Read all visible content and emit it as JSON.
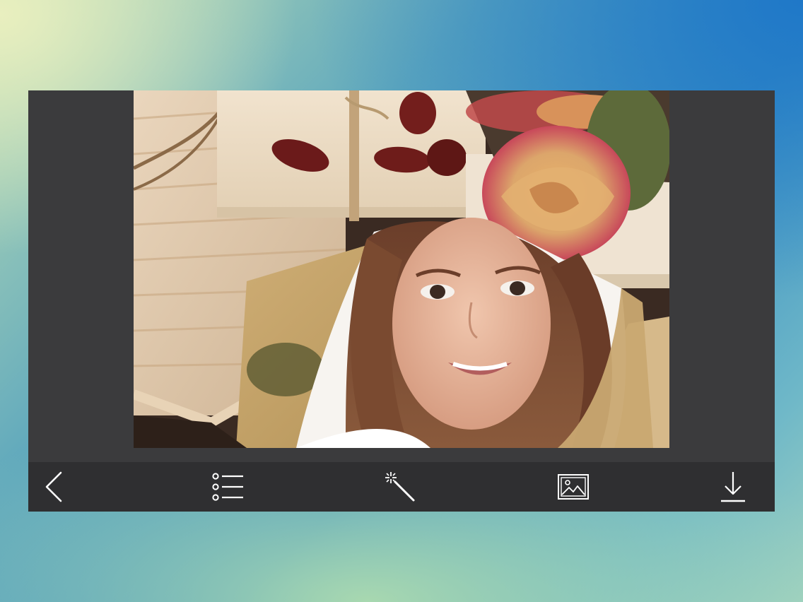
{
  "app": {
    "colors": {
      "frame": "#3b3b3d",
      "toolbar": "#2f2f31",
      "icon": "#ffffff"
    }
  },
  "photo": {
    "description_tag": "photo-frame-composite",
    "frame_style": "vintage-letters-with-dried-rose"
  },
  "toolbar": {
    "items": [
      {
        "name": "back",
        "icon": "chevron-left-icon"
      },
      {
        "name": "frames-list",
        "icon": "list-icon"
      },
      {
        "name": "effects",
        "icon": "magic-wand-icon"
      },
      {
        "name": "gallery",
        "icon": "image-icon"
      },
      {
        "name": "save",
        "icon": "download-icon"
      }
    ]
  }
}
